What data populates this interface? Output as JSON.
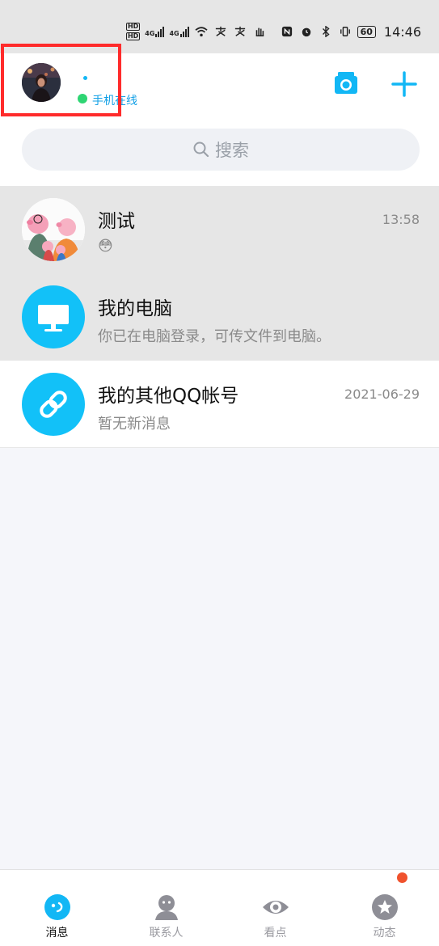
{
  "status_bar": {
    "hd1": "HD",
    "hd2": "HD",
    "net1": "4G",
    "net2": "4G",
    "battery": "60",
    "time": "14:46"
  },
  "header": {
    "online_status": "手机在线"
  },
  "search": {
    "placeholder": "搜索"
  },
  "conversations": [
    {
      "title": "测试",
      "subtitle": "😳",
      "time": "13:58",
      "avatar": "peppa-pig-family"
    },
    {
      "title": "我的电脑",
      "subtitle": "你已在电脑登录，可传文件到电脑。",
      "time": "",
      "avatar": "computer-icon"
    },
    {
      "title": "我的其他QQ帐号",
      "subtitle": "暂无新消息",
      "time": "2021-06-29",
      "avatar": "link-icon"
    }
  ],
  "bottom_nav": [
    {
      "label": "消息",
      "icon": "messages-icon",
      "active": true
    },
    {
      "label": "联系人",
      "icon": "contacts-icon",
      "active": false
    },
    {
      "label": "看点",
      "icon": "eye-icon",
      "active": false
    },
    {
      "label": "动态",
      "icon": "star-icon",
      "active": false
    }
  ],
  "colors": {
    "accent": "#12B7F5",
    "online": "#2ED573",
    "badge": "#F0522D",
    "highlight": "#FF2B2B"
  }
}
